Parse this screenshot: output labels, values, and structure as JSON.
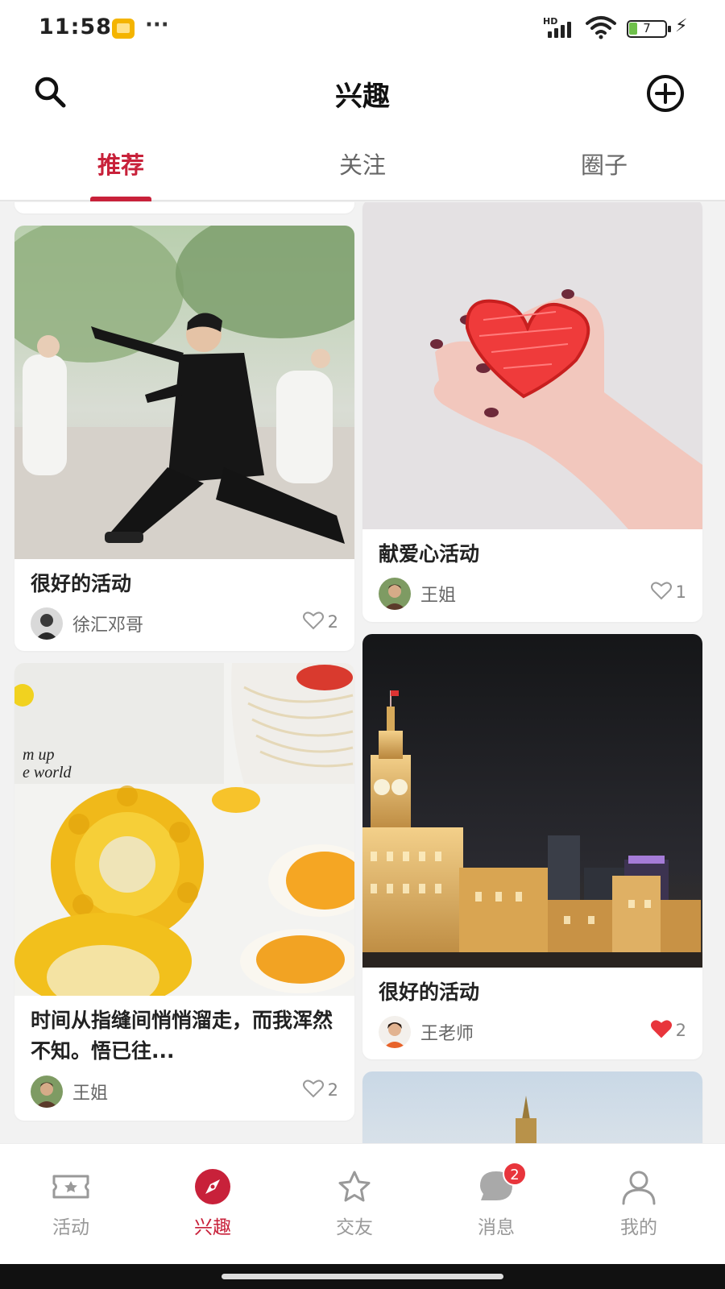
{
  "status_bar": {
    "time": "11:58",
    "more": "···",
    "network": "HD",
    "battery": "7"
  },
  "header": {
    "title": "兴趣",
    "search_icon": "search-icon",
    "add_icon": "add-circle-icon"
  },
  "tabs": [
    {
      "label": "推荐",
      "active": true
    },
    {
      "label": "关注",
      "active": false
    },
    {
      "label": "圈子",
      "active": false
    }
  ],
  "feed": {
    "cards": [
      {
        "title": "很好的活动",
        "author": "徐汇邓哥",
        "likes": "2",
        "liked": false,
        "image": "tai-chi-photo"
      },
      {
        "title": "献爱心活动",
        "author": "王姐",
        "likes": "1",
        "liked": false,
        "image": "heart-hand-photo"
      },
      {
        "title": "时间从指缝间悄悄溜走，而我浑然不知。悟已往...",
        "author": "王姐",
        "likes": "2",
        "liked": false,
        "image": "corn-eggs-photo"
      },
      {
        "title": "很好的活动",
        "author": "王老师",
        "likes": "2",
        "liked": true,
        "image": "bund-night-photo"
      }
    ]
  },
  "bottom_nav": [
    {
      "label": "活动",
      "icon": "ticket-icon",
      "active": false
    },
    {
      "label": "兴趣",
      "icon": "compass-icon",
      "active": true
    },
    {
      "label": "交友",
      "icon": "star-icon",
      "active": false
    },
    {
      "label": "消息",
      "icon": "message-icon",
      "active": false,
      "badge": "2"
    },
    {
      "label": "我的",
      "icon": "user-icon",
      "active": false
    }
  ],
  "colors": {
    "accent": "#c8213a",
    "badge": "#e8353c",
    "liked_heart": "#e8353c"
  }
}
